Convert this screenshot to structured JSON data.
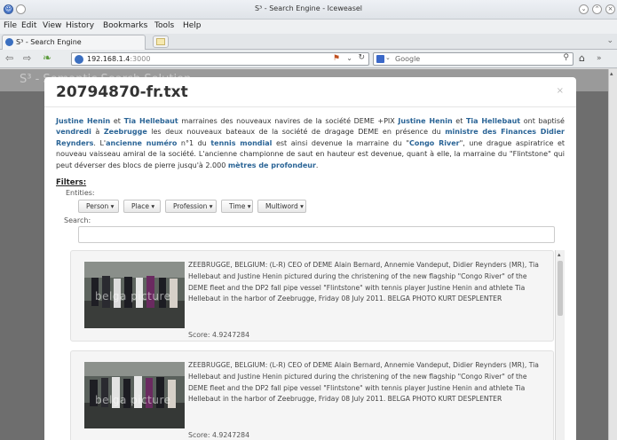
{
  "window": {
    "title": "S³ - Search Engine - Iceweasel"
  },
  "menu": [
    "File",
    "Edit",
    "View",
    "History",
    "Bookmarks",
    "Tools",
    "Help"
  ],
  "tab": {
    "label": "S³ - Search Engine",
    "new_tab_icon": "new-tab-icon"
  },
  "nav": {
    "url_host": "192.168.1.4",
    "url_port": ":3000",
    "search_engine": "Google"
  },
  "background_header": {
    "title": "S³ - Semantic Search Solution"
  },
  "modal": {
    "title": "20794870-fr.txt",
    "close": "×",
    "article": [
      {
        "t": "Justine Henin",
        "e": true
      },
      {
        "t": " et ",
        "e": false
      },
      {
        "t": "Tia Hellebaut",
        "e": true
      },
      {
        "t": " marraines des nouveaux navires de la société DEME +PIX ",
        "e": false
      },
      {
        "t": "Justine Henin",
        "e": true
      },
      {
        "t": " et ",
        "e": false
      },
      {
        "t": "Tia Hellebaut",
        "e": true
      },
      {
        "t": " ont baptisé ",
        "e": false
      },
      {
        "t": "vendredi",
        "e": true
      },
      {
        "t": " à ",
        "e": false
      },
      {
        "t": "Zeebrugge",
        "e": true
      },
      {
        "t": " les deux nouveaux bateaux de la société de dragage DEME en présence du ",
        "e": false
      },
      {
        "t": "ministre des Finances Didier Reynders",
        "e": true
      },
      {
        "t": ". L'",
        "e": false
      },
      {
        "t": "ancienne numéro",
        "e": true
      },
      {
        "t": " n°1 du ",
        "e": false
      },
      {
        "t": "tennis mondial",
        "e": true
      },
      {
        "t": " est ainsi devenue la marraine du \"",
        "e": false
      },
      {
        "t": "Congo River",
        "e": true
      },
      {
        "t": "\", une drague aspiratrice et nouveau vaisseau amiral de la société. L'ancienne championne de saut en hauteur est devenue, quant à elle, la marraine du \"Flintstone\" qui peut déverser des blocs de pierre jusqu'à 2.000 ",
        "e": false
      },
      {
        "t": "mètres de profondeur",
        "e": true
      },
      {
        "t": ".",
        "e": false
      }
    ],
    "filters_label": "Filters:",
    "entities_label": "Entities:",
    "filter_buttons": [
      "Person",
      "Place",
      "Profession",
      "Time",
      "Multiword"
    ],
    "search_label": "Search:",
    "search_value": "",
    "results": [
      {
        "caption": "ZEEBRUGGE, BELGIUM: (L-R) CEO of DEME Alain Bernard, Annemie Vandeput, Didier Reynders (MR), Tia Hellebaut and Justine Henin pictured during the christening of the new flagship \"Congo River\" of the DEME fleet and the DP2 fall pipe vessel \"Flintstone\" with tennis player Justine Henin and athlete Tia Hellebaut in the harbor of Zeebrugge, Friday 08 July 2011. BELGA PHOTO KURT DESPLENTER",
        "score": "Score: 4.9247284",
        "watermark": "belga picture"
      },
      {
        "caption": "ZEEBRUGGE, BELGIUM: (L-R) CEO of DEME Alain Bernard, Annemie Vandeput, Didier Reynders (MR), Tia Hellebaut and Justine Henin pictured during the christening of the new flagship \"Congo River\" of the DEME fleet and the DP2 fall pipe vessel \"Flintstone\" with tennis player Justine Henin and athlete Tia Hellebaut in the harbor of Zeebrugge, Friday 08 July 2011. BELGA PHOTO KURT DESPLENTER",
        "score": "Score: 4.9247284",
        "watermark": "belga picture"
      }
    ]
  },
  "colors": {
    "entity": "#2a6496",
    "overlay": "#6e6e6e"
  }
}
